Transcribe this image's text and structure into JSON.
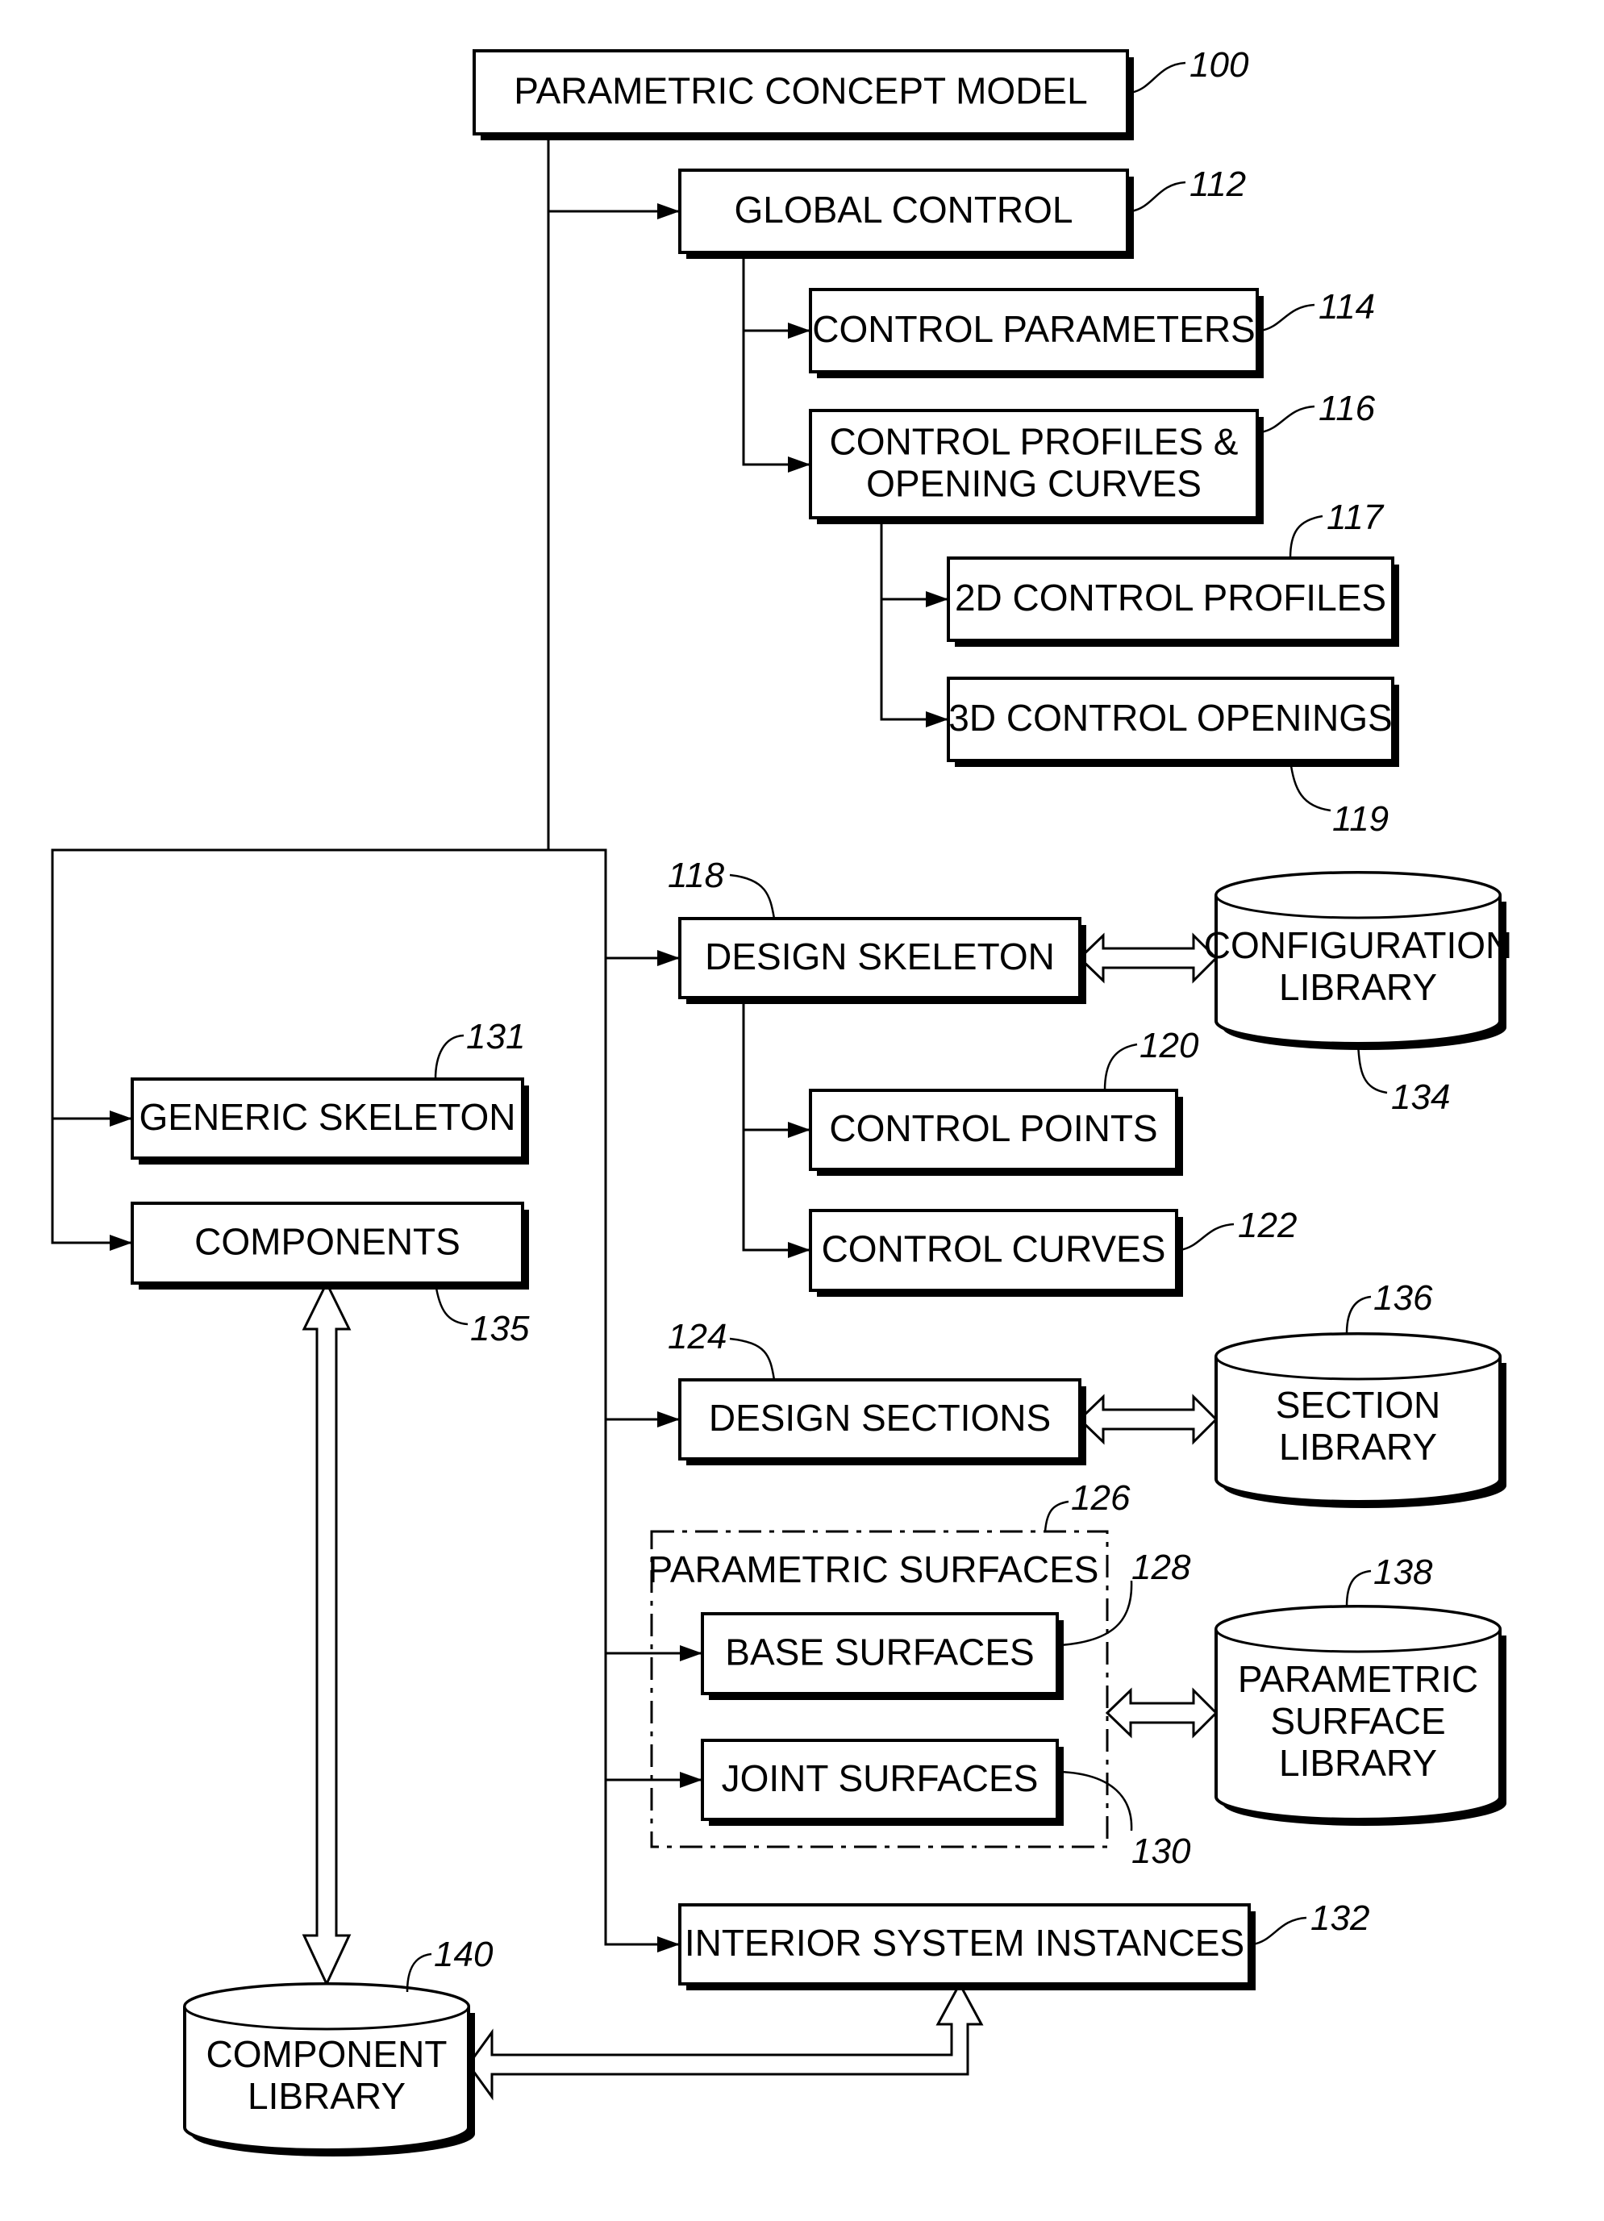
{
  "diagram": {
    "nodes": {
      "n100": {
        "label": [
          "PARAMETRIC CONCEPT MODEL"
        ],
        "ref": "100"
      },
      "n112": {
        "label": [
          "GLOBAL CONTROL"
        ],
        "ref": "112"
      },
      "n114": {
        "label": [
          "CONTROL PARAMETERS"
        ],
        "ref": "114"
      },
      "n116": {
        "label": [
          "CONTROL PROFILES &",
          "OPENING CURVES"
        ],
        "ref": "116"
      },
      "n117": {
        "label": [
          "2D CONTROL PROFILES"
        ],
        "ref": "117"
      },
      "n119": {
        "label": [
          "3D CONTROL OPENINGS"
        ],
        "ref": "119"
      },
      "n118": {
        "label": [
          "DESIGN SKELETON"
        ],
        "ref": "118"
      },
      "n134": {
        "label": [
          "CONFIGURATION",
          "LIBRARY"
        ],
        "ref": "134"
      },
      "n131": {
        "label": [
          "GENERIC SKELETON"
        ],
        "ref": "131"
      },
      "n135": {
        "label": [
          "COMPONENTS"
        ],
        "ref": "135"
      },
      "n120": {
        "label": [
          "CONTROL POINTS"
        ],
        "ref": "120"
      },
      "n122": {
        "label": [
          "CONTROL CURVES"
        ],
        "ref": "122"
      },
      "n124": {
        "label": [
          "DESIGN SECTIONS"
        ],
        "ref": "124"
      },
      "n136": {
        "label": [
          "SECTION",
          "LIBRARY"
        ],
        "ref": "136"
      },
      "n126": {
        "label": [
          "PARAMETRIC SURFACES"
        ],
        "ref": "126"
      },
      "n128": {
        "label": [
          "BASE SURFACES"
        ],
        "ref": "128"
      },
      "n130": {
        "label": [
          "JOINT SURFACES"
        ],
        "ref": "130"
      },
      "n138": {
        "label": [
          "PARAMETRIC",
          "SURFACE",
          "LIBRARY"
        ],
        "ref": "138"
      },
      "n132": {
        "label": [
          "INTERIOR SYSTEM INSTANCES"
        ],
        "ref": "132"
      },
      "n140": {
        "label": [
          "COMPONENT",
          "LIBRARY"
        ],
        "ref": "140"
      }
    },
    "edges": [
      {
        "from": "n100",
        "to": "n112",
        "type": "arrow"
      },
      {
        "from": "n112",
        "to": "n114",
        "type": "arrow"
      },
      {
        "from": "n112",
        "to": "n116",
        "type": "arrow"
      },
      {
        "from": "n116",
        "to": "n117",
        "type": "arrow"
      },
      {
        "from": "n116",
        "to": "n119",
        "type": "arrow"
      },
      {
        "from": "n100",
        "to": "n118",
        "type": "arrow"
      },
      {
        "from": "n100",
        "to": "n131",
        "type": "arrow"
      },
      {
        "from": "n100",
        "to": "n135",
        "type": "arrow"
      },
      {
        "from": "n118",
        "to": "n120",
        "type": "arrow"
      },
      {
        "from": "n118",
        "to": "n122",
        "type": "arrow"
      },
      {
        "from": "n100",
        "to": "n124",
        "type": "arrow"
      },
      {
        "from": "n100",
        "to": "n128",
        "type": "arrow"
      },
      {
        "from": "n100",
        "to": "n130",
        "type": "arrow"
      },
      {
        "from": "n100",
        "to": "n132",
        "type": "arrow"
      },
      {
        "from": "n118",
        "to": "n134",
        "type": "bidirectional"
      },
      {
        "from": "n124",
        "to": "n136",
        "type": "bidirectional"
      },
      {
        "from": "n126",
        "to": "n138",
        "type": "bidirectional"
      },
      {
        "from": "n135",
        "to": "n140",
        "type": "bidirectional"
      },
      {
        "from": "n140",
        "to": "n132",
        "type": "bidirectional"
      }
    ]
  }
}
